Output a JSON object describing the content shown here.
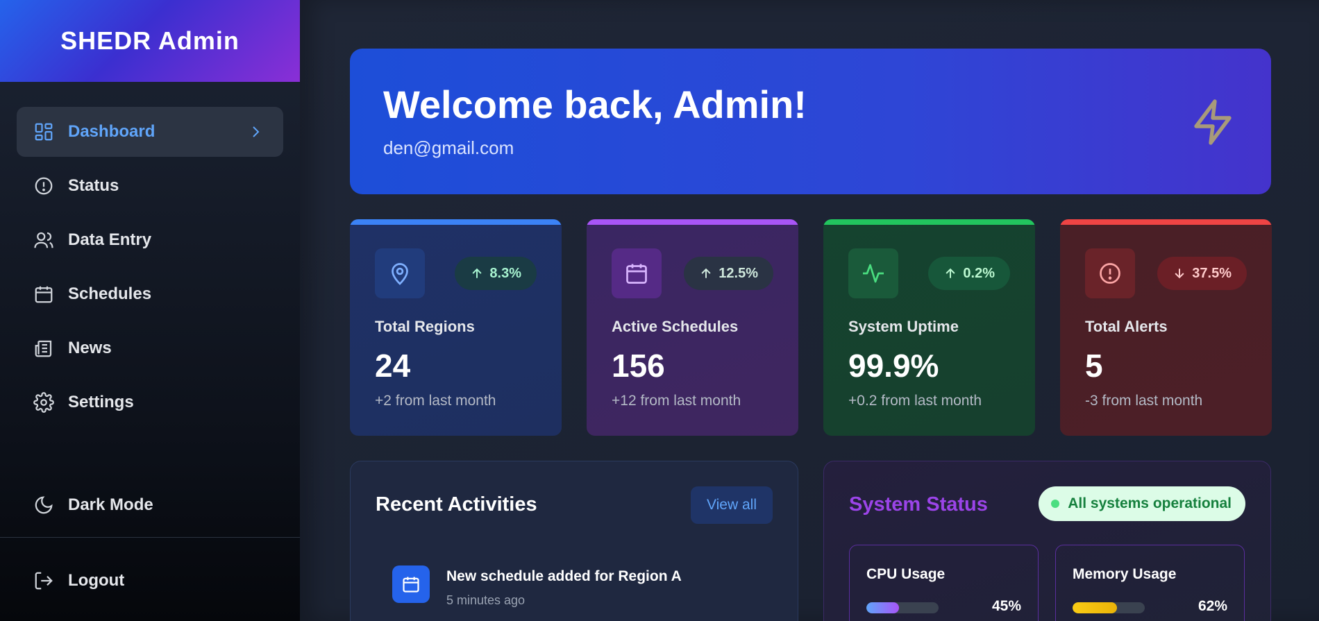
{
  "sidebar": {
    "brand": "SHEDR Admin",
    "items": [
      {
        "label": "Dashboard",
        "icon": "dashboard-icon"
      },
      {
        "label": "Status",
        "icon": "alert-circle-icon"
      },
      {
        "label": "Data Entry",
        "icon": "users-icon"
      },
      {
        "label": "Schedules",
        "icon": "calendar-icon"
      },
      {
        "label": "News",
        "icon": "newspaper-icon"
      },
      {
        "label": "Settings",
        "icon": "gear-icon"
      }
    ],
    "dark_mode_label": "Dark Mode",
    "logout_label": "Logout"
  },
  "hero": {
    "title": "Welcome back, Admin!",
    "email": "den@gmail.com",
    "icon": "lightning-icon"
  },
  "stats": [
    {
      "label": "Total Regions",
      "value": "24",
      "change": "8.3%",
      "direction": "up",
      "sub": "+2 from last month",
      "icon": "map-pin-icon",
      "accent": "#3b82f6"
    },
    {
      "label": "Active Schedules",
      "value": "156",
      "change": "12.5%",
      "direction": "up",
      "sub": "+12 from last month",
      "icon": "calendar-icon",
      "accent": "#a855f7"
    },
    {
      "label": "System Uptime",
      "value": "99.9%",
      "change": "0.2%",
      "direction": "up",
      "sub": "+0.2 from last month",
      "icon": "activity-icon",
      "accent": "#22c55e"
    },
    {
      "label": "Total Alerts",
      "value": "5",
      "change": "37.5%",
      "direction": "down",
      "sub": "-3 from last month",
      "icon": "alert-circle-icon",
      "accent": "#ef4444"
    }
  ],
  "recent_activities": {
    "title": "Recent Activities",
    "view_all_label": "View all",
    "items": [
      {
        "title": "New schedule added for Region A",
        "time": "5 minutes ago",
        "icon": "calendar-icon"
      }
    ]
  },
  "system_status": {
    "title": "System Status",
    "badge": "All systems operational",
    "metrics": [
      {
        "label": "CPU Usage",
        "value": "45%",
        "fraction": 0.45
      },
      {
        "label": "Memory Usage",
        "value": "62%",
        "fraction": 0.62
      }
    ]
  }
}
